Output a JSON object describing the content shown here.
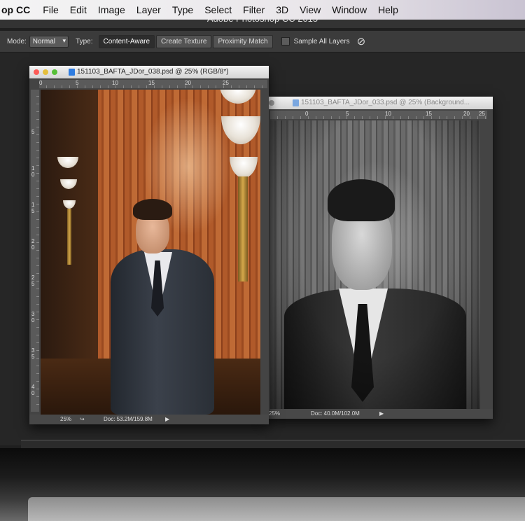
{
  "menubar": {
    "app_name": "op CC",
    "items": [
      "File",
      "Edit",
      "Image",
      "Layer",
      "Type",
      "Select",
      "Filter",
      "3D",
      "View",
      "Window",
      "Help"
    ]
  },
  "window_title": "Adobe Photoshop CC 2015",
  "options": {
    "mode_label": "Mode:",
    "mode_value": "Normal",
    "type_label": "Type:",
    "type_buttons": [
      "Content-Aware",
      "Create Texture",
      "Proximity Match"
    ],
    "sample_all_layers": "Sample All Layers"
  },
  "doc1": {
    "title": "151103_BAFTA_JDor_038.psd @ 25% (RGB/8*)",
    "ruler_h": [
      "0",
      "5",
      "10",
      "15",
      "20",
      "25"
    ],
    "ruler_v": [
      "5",
      "1 0",
      "1 5",
      "2 0",
      "2 5",
      "3 0",
      "3 5",
      "4 0"
    ],
    "zoom": "25%",
    "doc_size": "Doc: 53.2M/159.8M"
  },
  "doc2": {
    "title": "151103_BAFTA_JDor_033.psd @ 25% (Background...",
    "ruler_h": [
      "0",
      "5",
      "10",
      "15",
      "20",
      "25"
    ],
    "zoom": "25%",
    "doc_size": "Doc: 40.0M/102.0M"
  },
  "colors": {
    "traffic_close": "#fc5b57",
    "traffic_min": "#e5bf3c",
    "traffic_max": "#57c038"
  }
}
